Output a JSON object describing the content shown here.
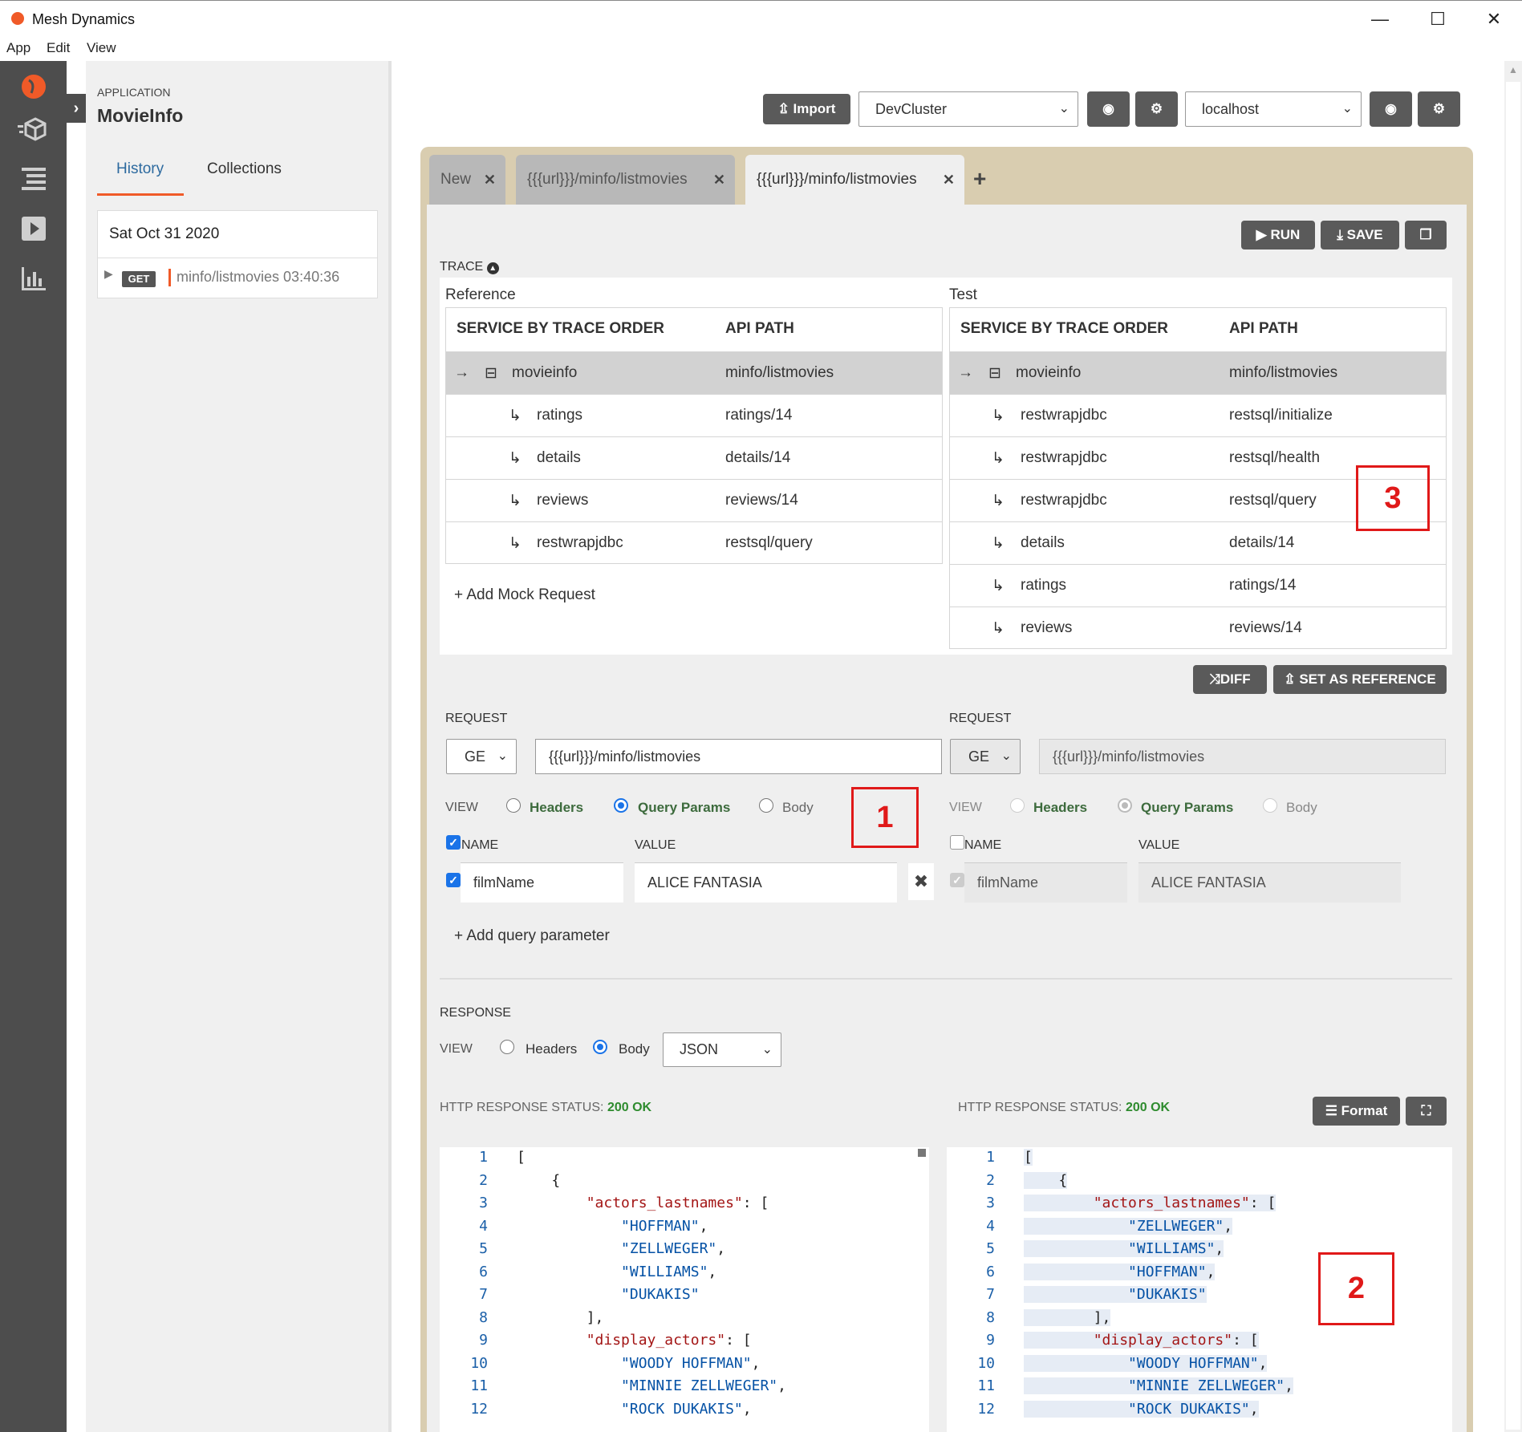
{
  "window": {
    "title": "Mesh Dynamics",
    "min": "—",
    "max": "☐",
    "close": "✕"
  },
  "menu": [
    "App",
    "Edit",
    "View"
  ],
  "sidebar": {
    "app_label": "APPLICATION",
    "app_name": "MovieInfo",
    "tabs": [
      "History",
      "Collections"
    ],
    "history_date": "Sat Oct 31 2020",
    "history_item": {
      "method": "GET",
      "path": "minfo/listmovies",
      "time": "03:40:36"
    }
  },
  "toolbar": {
    "import": "Import",
    "cluster": "DevCluster",
    "env": "localhost"
  },
  "tabs": [
    {
      "label": "New"
    },
    {
      "label": "{{{url}}}/minfo/listmovies"
    },
    {
      "label": "{{{url}}}/minfo/listmovies"
    }
  ],
  "actions": {
    "run": "RUN",
    "save": "SAVE",
    "diff": "DIFF",
    "set_ref": "SET AS REFERENCE",
    "format": "Format"
  },
  "trace": {
    "label": "TRACE",
    "reference_label": "Reference",
    "test_label": "Test",
    "col_service": "SERVICE BY TRACE ORDER",
    "col_path": "API PATH",
    "reference_rows": [
      {
        "service": "movieinfo",
        "path": "minfo/listmovies"
      },
      {
        "service": "ratings",
        "path": "ratings/14"
      },
      {
        "service": "details",
        "path": "details/14"
      },
      {
        "service": "reviews",
        "path": "reviews/14"
      },
      {
        "service": "restwrapjdbc",
        "path": "restsql/query"
      }
    ],
    "test_rows": [
      {
        "service": "movieinfo",
        "path": "minfo/listmovies"
      },
      {
        "service": "restwrapjdbc",
        "path": "restsql/initialize"
      },
      {
        "service": "restwrapjdbc",
        "path": "restsql/health"
      },
      {
        "service": "restwrapjdbc",
        "path": "restsql/query"
      },
      {
        "service": "details",
        "path": "details/14"
      },
      {
        "service": "ratings",
        "path": "ratings/14"
      },
      {
        "service": "reviews",
        "path": "reviews/14"
      }
    ],
    "add_mock": "Add Mock Request"
  },
  "request": {
    "label": "REQUEST",
    "method": "GE",
    "url": "{{{url}}}/minfo/listmovies",
    "view_label": "VIEW",
    "view_options": [
      "Headers",
      "Query Params",
      "Body"
    ],
    "name_col": "NAME",
    "value_col": "VALUE",
    "param_name": "filmName",
    "param_value": "ALICE FANTASIA",
    "add_param": "Add query parameter"
  },
  "response": {
    "label": "RESPONSE",
    "view_label": "VIEW",
    "view_options": [
      "Headers",
      "Body"
    ],
    "format_select": "JSON",
    "status_label": "HTTP RESPONSE STATUS:",
    "status_value": "200 OK"
  },
  "code_left": [
    "[",
    "    {",
    "        \"actors_lastnames\": [",
    "            \"HOFFMAN\",",
    "            \"ZELLWEGER\",",
    "            \"WILLIAMS\",",
    "            \"DUKAKIS\"",
    "        ],",
    "        \"display_actors\": [",
    "            \"WOODY HOFFMAN\",",
    "            \"MINNIE ZELLWEGER\",",
    "            \"ROCK DUKAKIS\","
  ],
  "code_right": [
    "[",
    "    {",
    "        \"actors_lastnames\": [",
    "            \"ZELLWEGER\",",
    "            \"WILLIAMS\",",
    "            \"HOFFMAN\",",
    "            \"DUKAKIS\"",
    "        ],",
    "        \"display_actors\": [",
    "            \"WOODY HOFFMAN\",",
    "            \"MINNIE ZELLWEGER\",",
    "            \"ROCK DUKAKIS\","
  ],
  "annotations": [
    "1",
    "2",
    "3"
  ]
}
